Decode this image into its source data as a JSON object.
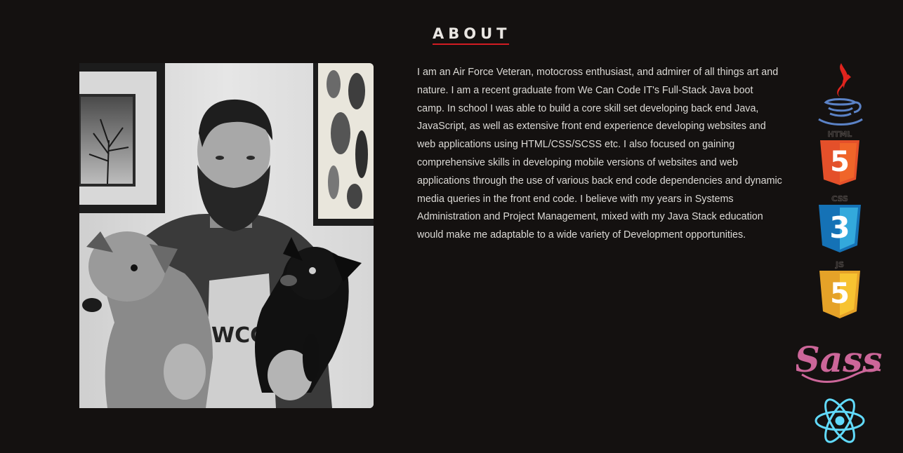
{
  "about": {
    "title": "ABOUT",
    "accent_color": "#d21c22",
    "bio": "I am an Air Force Veteran, motocross enthusiast, and admirer of all things art and nature. I am a recent graduate from We Can Code IT's Full-Stack Java boot camp. In school I was able to build a core skill set developing back end Java, JavaScript, as well as extensive front end experience developing websites and web applications using HTML/CSS/SCSS etc. I also focused on gaining comprehensive skills in developing mobile versions of websites and web applications through the use of various back end code dependencies and dynamic media queries in the front end code. I believe with my years in Systems Administration and Project Management, mixed with my Java Stack education would make me adaptable to a wide variety of Development opportunities.",
    "shirt_text": "WCCI"
  },
  "skills": {
    "icons": [
      "java-icon",
      "html5-icon",
      "css3-icon",
      "javascript-icon",
      "sass-icon",
      "react-icon"
    ],
    "html_label": "HTML",
    "html_glyph": "5",
    "css_label": "CSS",
    "css_glyph": "3",
    "js_label": "JS",
    "js_glyph": "5",
    "sass_label": "Sass"
  }
}
